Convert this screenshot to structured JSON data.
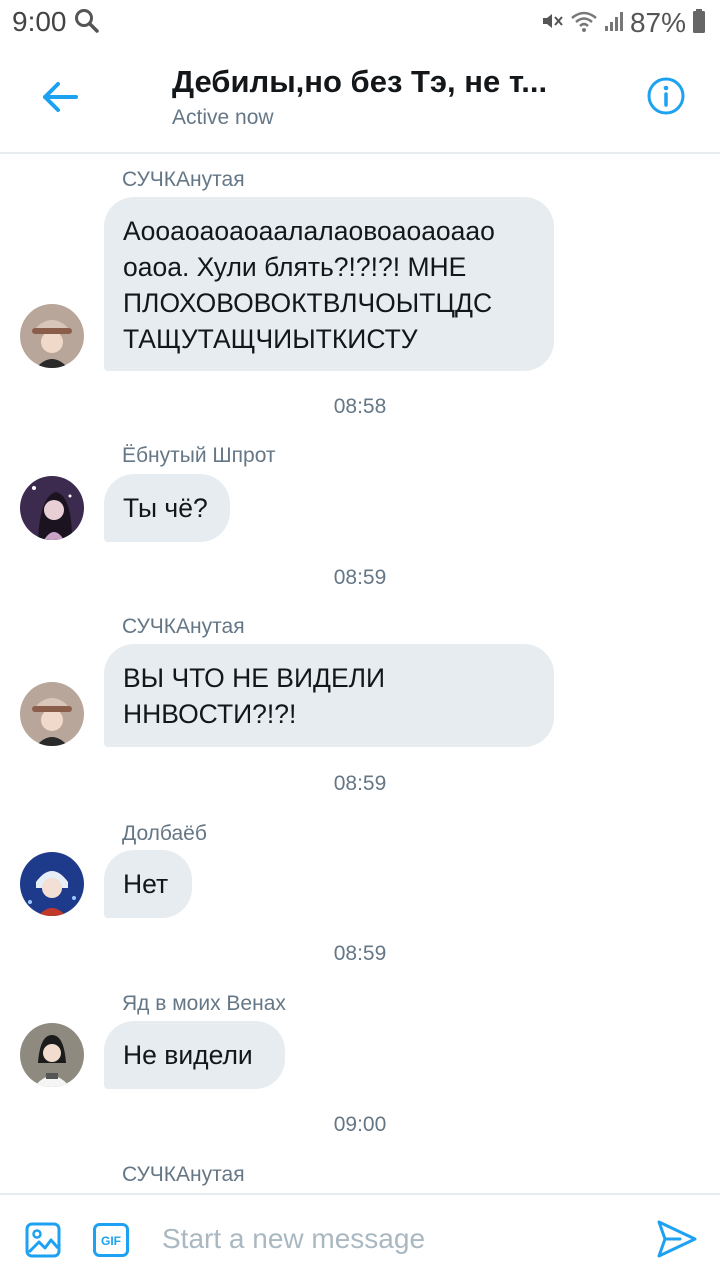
{
  "status_bar": {
    "time": "9:00",
    "battery": "87%",
    "icons": [
      "search-icon",
      "mute-vibrate-icon",
      "wifi-icon",
      "signal-icon",
      "battery-icon"
    ]
  },
  "header": {
    "title": "Дебилы,но без Тэ, не т...",
    "status": "Active now",
    "accent_color": "#1da1f2"
  },
  "messages": [
    {
      "sender": "СУЧКАнутая",
      "lines": [
        "Аооаоаоаоаалалаовоаоаоаао",
        "оаоа. Хули блять?!?!?! МНЕ",
        "ПЛОХОВОВОКТВЛЧОЫТЦДС",
        "ТАЩУТАЩЧИЫТКИСТУ"
      ],
      "time": "08:58"
    },
    {
      "sender": "Ёбнутый Шпрот",
      "lines": [
        "Ты чё?"
      ],
      "time": "08:59"
    },
    {
      "sender": "СУЧКАнутая",
      "lines": [
        "ВЫ ЧТО НЕ ВИДЕЛИ",
        "ННВОСТИ?!?!"
      ],
      "time": "08:59"
    },
    {
      "sender": "Долбаёб",
      "lines": [
        "Нет"
      ],
      "time": "08:59"
    },
    {
      "sender": "Яд в моих Венах",
      "lines": [
        "Не видели"
      ],
      "time": "09:00"
    },
    {
      "sender": "СУЧКАнутая"
    }
  ],
  "composer": {
    "placeholder": "Start a new message",
    "gif_label": "GIF"
  }
}
